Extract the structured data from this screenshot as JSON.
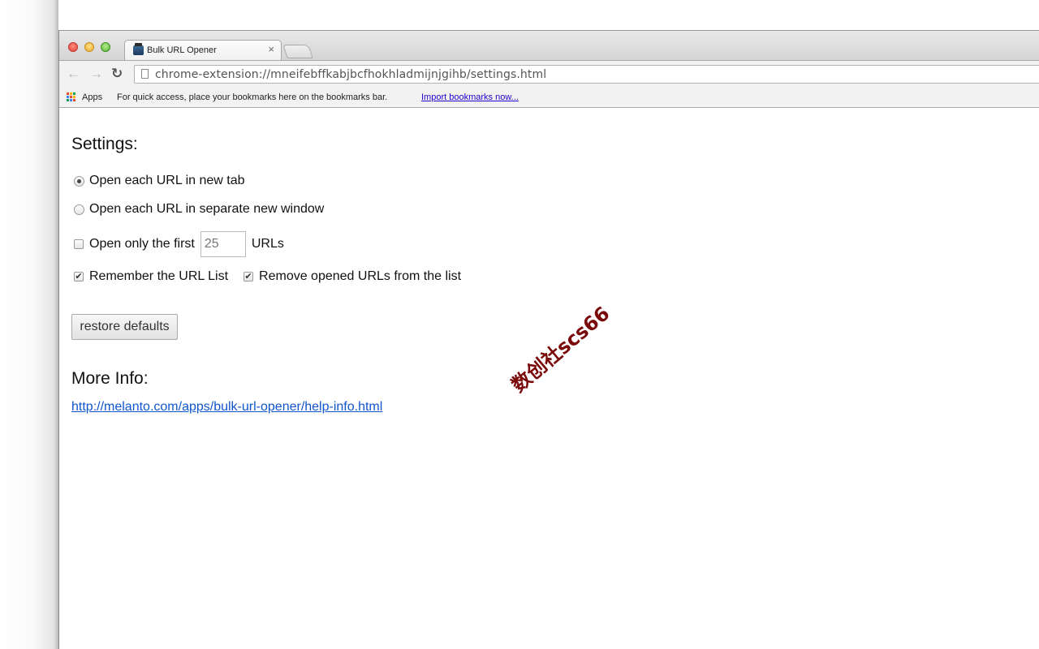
{
  "tab": {
    "title": "Bulk URL Opener",
    "close_glyph": "×"
  },
  "toolbar": {
    "url": "chrome-extension://mneifebffkabjbcfhokhladmijnjgihb/settings.html"
  },
  "bookmarks_bar": {
    "apps_label": "Apps",
    "hint": "For quick access, place your bookmarks here on the bookmarks bar.",
    "import_link": "Import bookmarks now..."
  },
  "settings": {
    "heading": "Settings:",
    "open_new_tab": {
      "label": "Open each URL in new tab",
      "checked": true
    },
    "open_new_window": {
      "label": "Open each URL in separate new window",
      "checked": false
    },
    "open_first": {
      "prefix": "Open only the first",
      "value": "25",
      "suffix": "URLs",
      "checked": false
    },
    "remember_list": {
      "label": "Remember the URL List",
      "checked": true
    },
    "remove_opened": {
      "label": "Remove opened URLs from the list",
      "checked": true
    },
    "restore_button": "restore defaults"
  },
  "more_info": {
    "heading": "More Info:",
    "link": "http://melanto.com/apps/bulk-url-opener/help-info.html"
  },
  "watermark": "数创社scs66",
  "colors": {
    "link": "#1155cc",
    "watermark": "#7a0a0a",
    "close_red": "#e0443e",
    "minimize_yellow": "#e9a92c",
    "zoom_green": "#58b536"
  }
}
